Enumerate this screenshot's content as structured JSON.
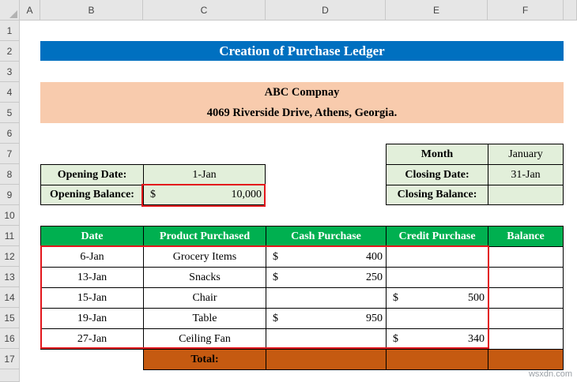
{
  "column_headers": [
    "A",
    "B",
    "C",
    "D",
    "E",
    "F"
  ],
  "row_headers": [
    "1",
    "2",
    "3",
    "4",
    "5",
    "6",
    "7",
    "8",
    "9",
    "10",
    "11",
    "12",
    "13",
    "14",
    "15",
    "16",
    "17"
  ],
  "title": "Creation of Purchase Ledger",
  "company": {
    "name": "ABC Compnay",
    "address": "4069 Riverside Drive, Athens, Georgia."
  },
  "opening": {
    "date_label": "Opening Date:",
    "date_value": "1-Jan",
    "balance_label": "Opening Balance:",
    "balance_currency": "$",
    "balance_value": "10,000"
  },
  "closing": {
    "month_label": "Month",
    "month_value": "January",
    "date_label": "Closing Date:",
    "date_value": "31-Jan",
    "balance_label": "Closing Balance:",
    "balance_value": ""
  },
  "ledger": {
    "headers": [
      "Date",
      "Product Purchased",
      "Cash Purchase",
      "Credit Purchase",
      "Balance"
    ],
    "rows": [
      {
        "date": "6-Jan",
        "product": "Grocery Items",
        "cash_cur": "$",
        "cash": "400",
        "credit_cur": "",
        "credit": "",
        "balance": ""
      },
      {
        "date": "13-Jan",
        "product": "Snacks",
        "cash_cur": "$",
        "cash": "250",
        "credit_cur": "",
        "credit": "",
        "balance": ""
      },
      {
        "date": "15-Jan",
        "product": "Chair",
        "cash_cur": "",
        "cash": "",
        "credit_cur": "$",
        "credit": "500",
        "balance": ""
      },
      {
        "date": "19-Jan",
        "product": "Table",
        "cash_cur": "$",
        "cash": "950",
        "credit_cur": "",
        "credit": "",
        "balance": ""
      },
      {
        "date": "27-Jan",
        "product": "Ceiling Fan",
        "cash_cur": "",
        "cash": "",
        "credit_cur": "$",
        "credit": "340",
        "balance": ""
      }
    ],
    "total_label": "Total:"
  },
  "colors": {
    "title_bg": "#0070c0",
    "company_bg": "#f8cbad",
    "light_green": "#e2efda",
    "header_green": "#00b050",
    "total_brown": "#c55a11",
    "highlight_red": "#e3161c"
  },
  "watermark": "wsxdn.com"
}
